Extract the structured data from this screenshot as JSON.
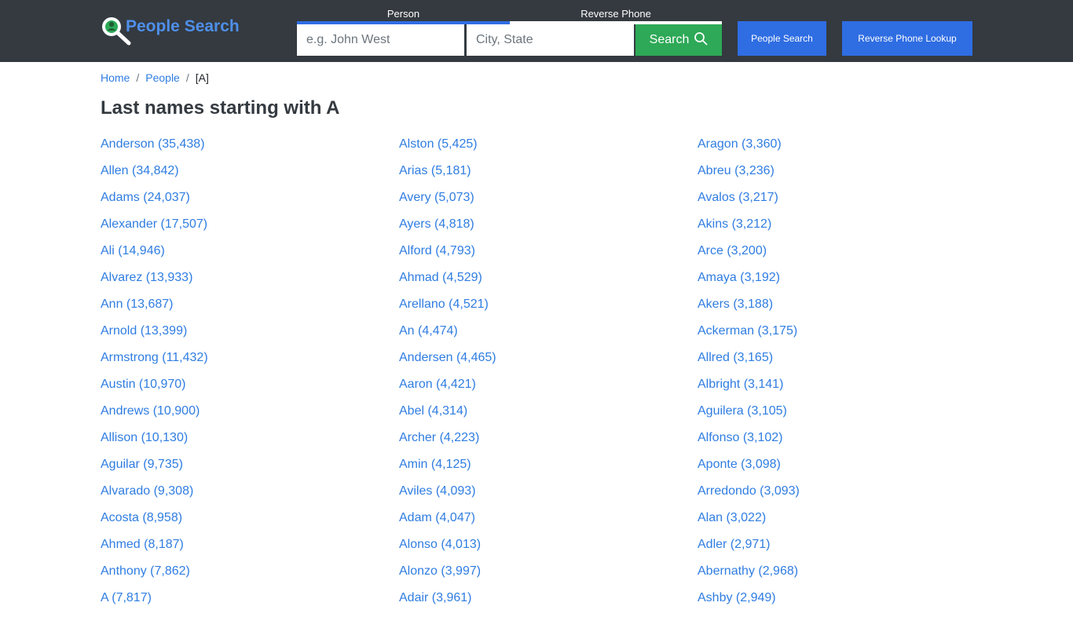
{
  "header": {
    "logo_text": "People Search",
    "tabs": [
      {
        "label": "Person",
        "active": true
      },
      {
        "label": "Reverse Phone",
        "active": false
      }
    ],
    "name_placeholder": "e.g. John West",
    "location_placeholder": "City, State",
    "search_label": "Search",
    "nav": {
      "people_search": "People Search",
      "reverse_phone_lookup": "Reverse Phone Lookup"
    }
  },
  "breadcrumb": {
    "home": "Home",
    "people": "People",
    "current": "[A]",
    "separator": "/"
  },
  "page_title": "Last names starting with A",
  "columns": [
    [
      "Anderson (35,438)",
      "Allen (34,842)",
      "Adams (24,037)",
      "Alexander (17,507)",
      "Ali (14,946)",
      "Alvarez (13,933)",
      "Ann (13,687)",
      "Arnold (13,399)",
      "Armstrong (11,432)",
      "Austin (10,970)",
      "Andrews (10,900)",
      "Allison (10,130)",
      "Aguilar (9,735)",
      "Alvarado (9,308)",
      "Acosta (8,958)",
      "Ahmed (8,187)",
      "Anthony (7,862)",
      "A (7,817)"
    ],
    [
      "Alston (5,425)",
      "Arias (5,181)",
      "Avery (5,073)",
      "Ayers (4,818)",
      "Alford (4,793)",
      "Ahmad (4,529)",
      "Arellano (4,521)",
      "An (4,474)",
      "Andersen (4,465)",
      "Aaron (4,421)",
      "Abel (4,314)",
      "Archer (4,223)",
      "Amin (4,125)",
      "Aviles (4,093)",
      "Adam (4,047)",
      "Alonso (4,013)",
      "Alonzo (3,997)",
      "Adair (3,961)"
    ],
    [
      "Aragon (3,360)",
      "Abreu (3,236)",
      "Avalos (3,217)",
      "Akins (3,212)",
      "Arce (3,200)",
      "Amaya (3,192)",
      "Akers (3,188)",
      "Ackerman (3,175)",
      "Allred (3,165)",
      "Albright (3,141)",
      "Aguilera (3,105)",
      "Alfonso (3,102)",
      "Aponte (3,098)",
      "Arredondo (3,093)",
      "Alan (3,022)",
      "Adler (2,971)",
      "Abernathy (2,968)",
      "Ashby (2,949)"
    ]
  ],
  "colors": {
    "topbar": "#343a40",
    "accent_blue": "#2f6de3",
    "search_green": "#2ea957",
    "link": "#2f7de1",
    "logo_text": "#4f8fea"
  },
  "icons": {
    "logo": "magnifier-person-icon",
    "search": "search-icon"
  }
}
